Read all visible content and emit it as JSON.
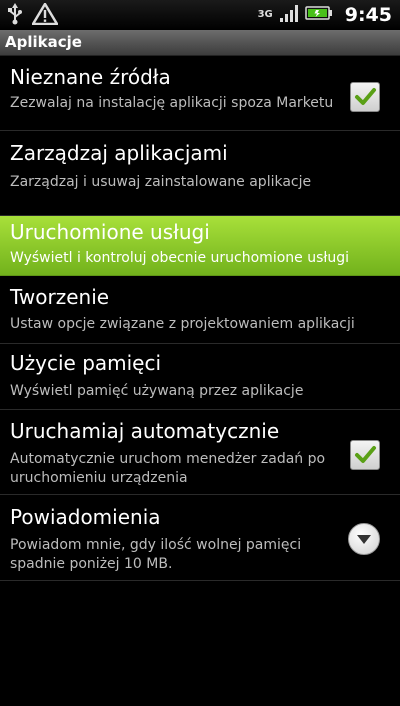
{
  "status_bar": {
    "network": "3G",
    "time": "9:45",
    "icons": [
      "usb-icon",
      "warning-icon",
      "signal-icon",
      "battery-icon"
    ]
  },
  "header": {
    "title": "Aplikacje"
  },
  "settings": [
    {
      "title": "Nieznane źródła",
      "subtitle": "Zezwalaj na instalację aplikacji spoza Marketu",
      "control": "checkbox",
      "checked": true
    },
    {
      "title": "Zarządzaj aplikacjami",
      "subtitle": "Zarządzaj i usuwaj zainstalowane aplikacje",
      "control": "none"
    },
    {
      "title": "Uruchomione usługi",
      "subtitle": "Wyświetl i kontroluj obecnie uruchomione usługi",
      "control": "none",
      "selected": true
    },
    {
      "title": "Tworzenie",
      "subtitle": "Ustaw opcje związane z projektowaniem aplikacji",
      "control": "none"
    },
    {
      "title": "Użycie pamięci",
      "subtitle": "Wyświetl pamięć używaną przez aplikacje",
      "control": "none"
    },
    {
      "title": "Uruchamiaj automatycznie",
      "subtitle": "Automatycznie uruchom menedżer zadań po uruchomieniu urządzenia",
      "control": "checkbox",
      "checked": true
    },
    {
      "title": "Powiadomienia",
      "subtitle": "Powiadom mnie, gdy ilość wolnej pamięci spadnie poniżej 10 MB.",
      "control": "dropdown"
    }
  ],
  "colors": {
    "accent": "#8cc63f",
    "check": "#5aa016",
    "background": "#000000"
  }
}
